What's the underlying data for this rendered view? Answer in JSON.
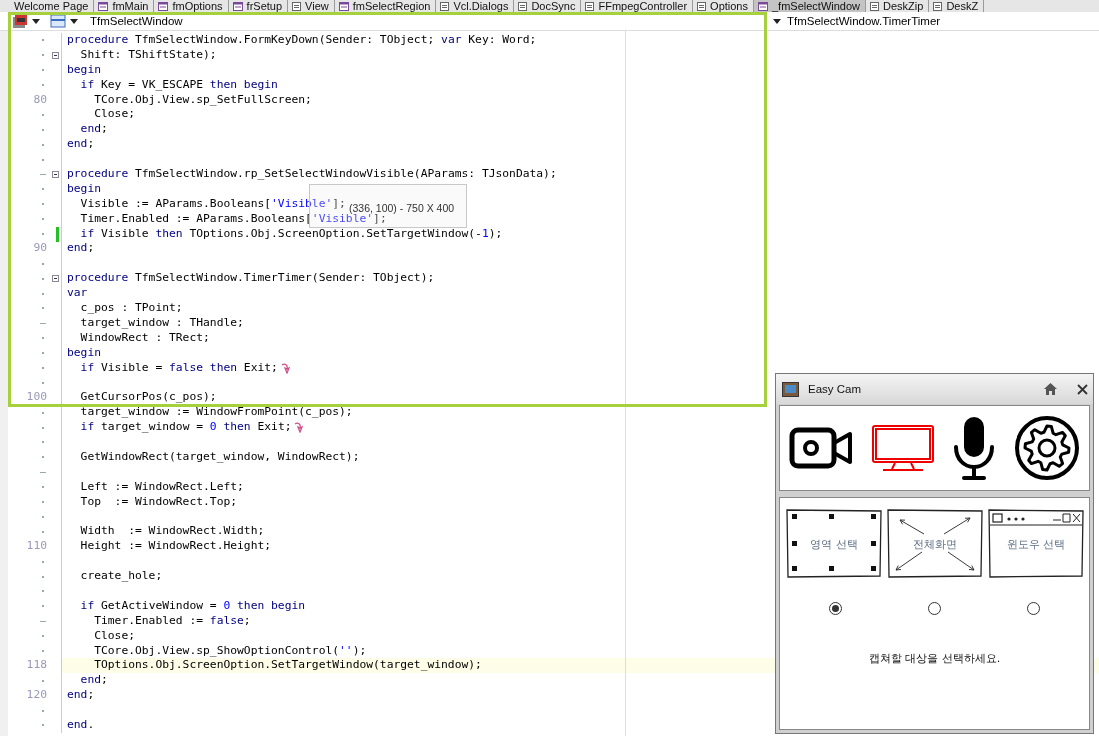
{
  "tabs": [
    {
      "label": "Welcome Page",
      "kind": "none",
      "selected": false
    },
    {
      "label": "fmMain",
      "kind": "form",
      "selected": false
    },
    {
      "label": "fmOptions",
      "kind": "form",
      "selected": false
    },
    {
      "label": "frSetup",
      "kind": "form",
      "selected": false
    },
    {
      "label": "View",
      "kind": "unit",
      "selected": false
    },
    {
      "label": "fmSelectRegion",
      "kind": "form",
      "selected": false
    },
    {
      "label": "Vcl.Dialogs",
      "kind": "unit",
      "selected": false
    },
    {
      "label": "DocSync",
      "kind": "unit",
      "selected": false
    },
    {
      "label": "FFmpegController",
      "kind": "unit",
      "selected": false
    },
    {
      "label": "Options",
      "kind": "unit",
      "selected": false
    },
    {
      "label": "_fmSelectWindow",
      "kind": "form",
      "selected": true
    },
    {
      "label": "DeskZip",
      "kind": "unit",
      "selected": false
    },
    {
      "label": "DeskZ",
      "kind": "unit",
      "selected": false
    }
  ],
  "editor": {
    "class_selector": "TfmSelectWindow",
    "method_selector": "TfmSelectWindow.TimerTimer",
    "lines": [
      {
        "kind": "dot",
        "fold": false,
        "modified": false,
        "current": false,
        "code": [
          {
            "kind": "keyword",
            "text": "procedure"
          },
          {
            "text": " TfmSelectWindow.FormKeyDown(Sender: TObject; "
          },
          {
            "kind": "keyword",
            "text": "var"
          },
          {
            "text": " Key: Word;"
          }
        ]
      },
      {
        "kind": "dot",
        "fold": true,
        "modified": false,
        "current": false,
        "code": [
          {
            "text": "  Shift: TShiftState);"
          }
        ]
      },
      {
        "kind": "dot",
        "fold": false,
        "modified": false,
        "current": false,
        "code": [
          {
            "kind": "keyword",
            "text": "begin"
          }
        ]
      },
      {
        "kind": "dot",
        "fold": false,
        "modified": false,
        "current": false,
        "code": [
          {
            "kind": "keyword",
            "text": "  if"
          },
          {
            "text": " Key = VK_ESCAPE "
          },
          {
            "kind": "keyword",
            "text": "then begin"
          }
        ]
      },
      {
        "kind": "numbered",
        "number": "80",
        "fold": false,
        "modified": false,
        "current": false,
        "code": [
          {
            "text": "    TCore.Obj.View.sp_SetFullScreen;"
          }
        ]
      },
      {
        "kind": "dot",
        "fold": false,
        "modified": false,
        "current": false,
        "code": [
          {
            "text": "    Close;"
          }
        ]
      },
      {
        "kind": "dot",
        "fold": false,
        "modified": false,
        "current": false,
        "code": [
          {
            "kind": "keyword",
            "text": "  end"
          },
          {
            "text": ";"
          }
        ]
      },
      {
        "kind": "dot",
        "fold": false,
        "modified": false,
        "current": false,
        "code": [
          {
            "kind": "keyword",
            "text": "end"
          },
          {
            "text": ";"
          }
        ]
      },
      {
        "kind": "dot",
        "fold": false,
        "modified": false,
        "current": false
      },
      {
        "kind": "dash",
        "fold": true,
        "modified": false,
        "current": false,
        "code": [
          {
            "kind": "keyword",
            "text": "procedure"
          },
          {
            "text": " TfmSelectWindow.rp_SetSelectWindowVisible(AParams: TJsonData);"
          }
        ]
      },
      {
        "kind": "dot",
        "fold": false,
        "modified": false,
        "current": false,
        "code": [
          {
            "kind": "keyword",
            "text": "begin"
          }
        ]
      },
      {
        "kind": "dot",
        "fold": false,
        "modified": false,
        "current": false,
        "code": [
          {
            "text": "  Visible := AParams.Booleans["
          },
          {
            "kind": "literal",
            "text": "'Visible'"
          },
          {
            "text": "];"
          }
        ]
      },
      {
        "kind": "dot",
        "fold": false,
        "modified": false,
        "current": false,
        "code": [
          {
            "text": "  Timer.Enabled := AParams.Booleans["
          },
          {
            "kind": "literal",
            "text": "'Visible'"
          },
          {
            "text": "];"
          }
        ]
      },
      {
        "kind": "dot",
        "fold": false,
        "modified": true,
        "current": false,
        "code": [
          {
            "kind": "keyword",
            "text": "  if"
          },
          {
            "text": " Visible "
          },
          {
            "kind": "keyword",
            "text": "then"
          },
          {
            "text": " TOptions.Obj.ScreenOption.SetTargetWindow(-"
          },
          {
            "kind": "literal",
            "text": "1"
          },
          {
            "text": ");"
          }
        ]
      },
      {
        "kind": "numbered",
        "number": "90",
        "fold": false,
        "modified": false,
        "current": false,
        "code": [
          {
            "kind": "keyword",
            "text": "end"
          },
          {
            "text": ";"
          }
        ]
      },
      {
        "kind": "dot",
        "fold": false,
        "modified": false,
        "current": false
      },
      {
        "kind": "dot",
        "fold": true,
        "modified": false,
        "current": false,
        "code": [
          {
            "kind": "keyword",
            "text": "procedure"
          },
          {
            "text": " TfmSelectWindow.TimerTimer(Sender: TObject);"
          }
        ]
      },
      {
        "kind": "dot",
        "fold": false,
        "modified": false,
        "current": false,
        "code": [
          {
            "kind": "keyword",
            "text": "var"
          }
        ]
      },
      {
        "kind": "dot",
        "fold": false,
        "modified": false,
        "current": false,
        "code": [
          {
            "text": "  c_pos : TPoint;"
          }
        ]
      },
      {
        "kind": "dash",
        "fold": false,
        "modified": false,
        "current": false,
        "code": [
          {
            "text": "  target_window : THandle;"
          }
        ]
      },
      {
        "kind": "dot",
        "fold": false,
        "modified": false,
        "current": false,
        "code": [
          {
            "text": "  WindowRect : TRect;"
          }
        ]
      },
      {
        "kind": "dot",
        "fold": false,
        "modified": false,
        "current": false,
        "code": [
          {
            "kind": "keyword",
            "text": "begin"
          }
        ]
      },
      {
        "kind": "dot",
        "fold": false,
        "modified": false,
        "current": false,
        "code": [
          {
            "kind": "keyword",
            "text": "  if"
          },
          {
            "text": " Visible = "
          },
          {
            "kind": "keyword",
            "text": "false then"
          },
          {
            "text": " Exit;"
          },
          {
            "kind": "exit"
          }
        ]
      },
      {
        "kind": "dot",
        "fold": false,
        "modified": false,
        "current": false
      },
      {
        "kind": "numbered",
        "number": "100",
        "fold": false,
        "modified": false,
        "current": false,
        "code": [
          {
            "text": "  GetCursorPos(c_pos);"
          }
        ]
      },
      {
        "kind": "dot",
        "fold": false,
        "modified": false,
        "current": false,
        "code": [
          {
            "text": "  target_window := WindowFromPoint(c_pos);"
          }
        ]
      },
      {
        "kind": "dot",
        "fold": false,
        "modified": false,
        "current": false,
        "code": [
          {
            "kind": "keyword",
            "text": "  if"
          },
          {
            "text": " target_window = "
          },
          {
            "kind": "literal",
            "text": "0"
          },
          {
            "kind": "keyword",
            "text": " then"
          },
          {
            "text": " Exit;"
          },
          {
            "kind": "exit"
          }
        ]
      },
      {
        "kind": "dot",
        "fold": false,
        "modified": false,
        "current": false
      },
      {
        "kind": "dot",
        "fold": false,
        "modified": false,
        "current": false,
        "code": [
          {
            "text": "  GetWindowRect(target_window, WindowRect);"
          }
        ]
      },
      {
        "kind": "dash",
        "fold": false,
        "modified": false,
        "current": false
      },
      {
        "kind": "dot",
        "fold": false,
        "modified": false,
        "current": false,
        "code": [
          {
            "text": "  Left := WindowRect.Left;"
          }
        ]
      },
      {
        "kind": "dot",
        "fold": false,
        "modified": false,
        "current": false,
        "code": [
          {
            "text": "  Top  := WindowRect.Top;"
          }
        ]
      },
      {
        "kind": "dot",
        "fold": false,
        "modified": false,
        "current": false
      },
      {
        "kind": "dot",
        "fold": false,
        "modified": false,
        "current": false,
        "code": [
          {
            "text": "  Width  := WindowRect.Width;"
          }
        ]
      },
      {
        "kind": "numbered",
        "number": "110",
        "fold": false,
        "modified": false,
        "current": false,
        "code": [
          {
            "text": "  Height := WindowRect.Height;"
          }
        ]
      },
      {
        "kind": "dot",
        "fold": false,
        "modified": false,
        "current": false
      },
      {
        "kind": "dot",
        "fold": false,
        "modified": false,
        "current": false,
        "code": [
          {
            "text": "  create_hole;"
          }
        ]
      },
      {
        "kind": "dot",
        "fold": false,
        "modified": false,
        "current": false
      },
      {
        "kind": "dot",
        "fold": false,
        "modified": false,
        "current": false,
        "code": [
          {
            "kind": "keyword",
            "text": "  if"
          },
          {
            "text": " GetActiveWindow = "
          },
          {
            "kind": "literal",
            "text": "0"
          },
          {
            "kind": "keyword",
            "text": " then begin"
          }
        ]
      },
      {
        "kind": "dash",
        "fold": false,
        "modified": false,
        "current": false,
        "code": [
          {
            "text": "    Timer.Enabled := "
          },
          {
            "kind": "keyword",
            "text": "false"
          },
          {
            "text": ";"
          }
        ]
      },
      {
        "kind": "dot",
        "fold": false,
        "modified": false,
        "current": false,
        "code": [
          {
            "text": "    Close;"
          }
        ]
      },
      {
        "kind": "dot",
        "fold": false,
        "modified": false,
        "current": false,
        "code": [
          {
            "text": "    TCore.Obj.View.sp_ShowOptionControl("
          },
          {
            "kind": "literal",
            "text": "''"
          },
          {
            "text": ");"
          }
        ]
      },
      {
        "kind": "numbered",
        "number": "118",
        "fold": false,
        "modified": false,
        "current": true,
        "code": [
          {
            "text": "    TOptions.Obj.ScreenOption.SetTargetWindow(target_window);"
          }
        ]
      },
      {
        "kind": "dot",
        "fold": false,
        "modified": false,
        "current": false,
        "code": [
          {
            "kind": "keyword",
            "text": "  end"
          },
          {
            "text": ";"
          }
        ]
      },
      {
        "kind": "numbered",
        "number": "120",
        "fold": false,
        "modified": false,
        "current": false,
        "code": [
          {
            "kind": "keyword",
            "text": "end"
          },
          {
            "text": ";"
          }
        ]
      },
      {
        "kind": "dot",
        "fold": false,
        "modified": false,
        "current": false
      },
      {
        "kind": "dot",
        "fold": false,
        "modified": false,
        "current": false,
        "code": [
          {
            "kind": "keyword",
            "text": "end"
          },
          {
            "text": "."
          }
        ]
      }
    ]
  },
  "tooltip": "(336, 100) - 750 X 400",
  "easy_cam": {
    "title": "Easy Cam",
    "tools": [
      {
        "kind": "camera",
        "selected": false
      },
      {
        "kind": "monitor",
        "selected": true
      },
      {
        "kind": "mic",
        "selected": false
      },
      {
        "kind": "gear",
        "selected": false
      }
    ],
    "modes": [
      {
        "kind": "region",
        "label": "영역 선택",
        "selected": true
      },
      {
        "kind": "fullscreen",
        "label": "전체화면",
        "selected": false
      },
      {
        "kind": "window",
        "label": "윈도우 선택",
        "selected": false
      }
    ],
    "message": "캡쳐할 대상을 선택하세요."
  }
}
